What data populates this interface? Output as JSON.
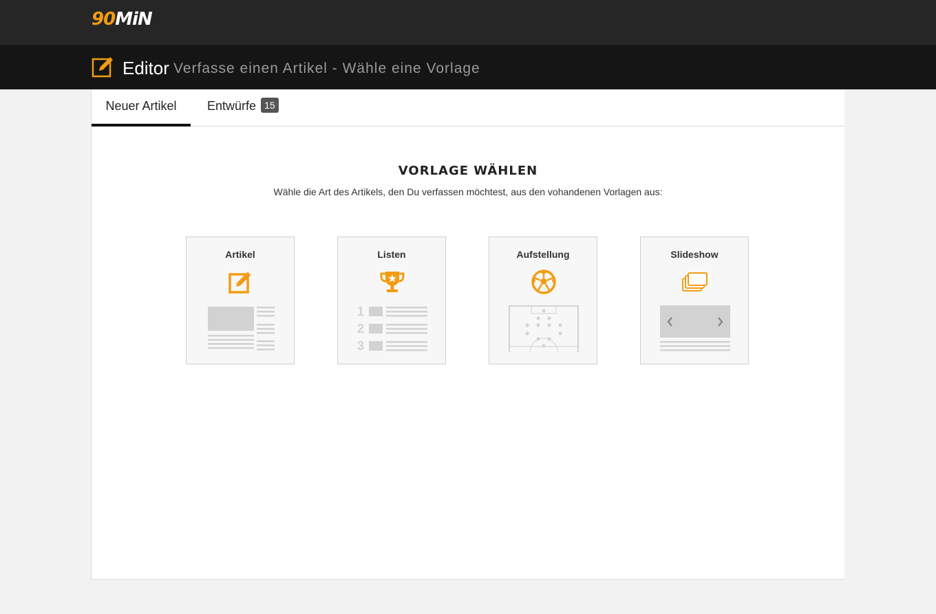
{
  "header": {
    "logo_number": "90",
    "logo_text": "MiN"
  },
  "editor_bar": {
    "title": "Editor",
    "subtitle": "Verfasse einen Artikel - Wähle eine Vorlage"
  },
  "tabs": [
    {
      "label": "Neuer Artikel",
      "active": true
    },
    {
      "label": "Entwürfe",
      "badge": "15",
      "active": false
    }
  ],
  "content": {
    "heading": "VORLAGE WÄHLEN",
    "description": "Wähle die Art des Artikels, den Du verfassen möchtest, aus den vohandenen Vorlagen aus:"
  },
  "templates": [
    {
      "label": "Artikel",
      "icon": "edit-icon"
    },
    {
      "label": "Listen",
      "icon": "trophy-icon",
      "list_numbers": [
        "1",
        "2",
        "3"
      ]
    },
    {
      "label": "Aufstellung",
      "icon": "soccer-ball-icon"
    },
    {
      "label": "Slideshow",
      "icon": "gallery-icon"
    }
  ],
  "colors": {
    "accent": "#f39c12",
    "topbar": "#262626",
    "editorbar": "#151515",
    "page_bg": "#f2f2f2",
    "preview_gray": "#d2d2d2"
  }
}
